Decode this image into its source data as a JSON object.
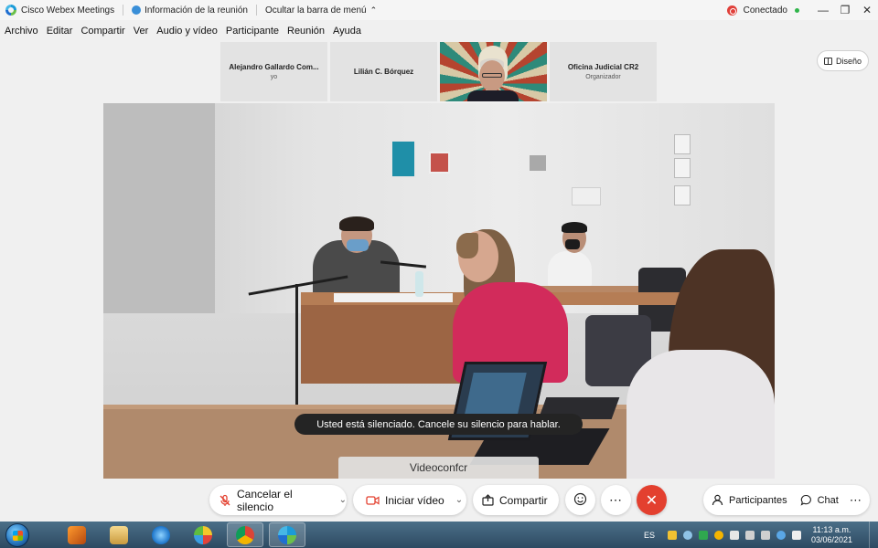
{
  "titlebar": {
    "app_title": "Cisco Webex Meetings",
    "meeting_info": "Información de la reunión",
    "hide_menu": "Ocultar la barra de menú",
    "status": "Conectado",
    "status_color": "#2fb54a"
  },
  "menu": {
    "items": [
      "Archivo",
      "Editar",
      "Compartir",
      "Ver",
      "Audio y vídeo",
      "Participante",
      "Reunión",
      "Ayuda"
    ]
  },
  "participants": [
    {
      "name": "Alejandro Gallardo Com...",
      "role": "yo"
    },
    {
      "name": "Lilián C. Bórquez",
      "role": ""
    },
    {
      "name": "",
      "role": ""
    },
    {
      "name": "Oficina Judicial CR2",
      "role": "Organizador"
    }
  ],
  "layout_button": "Diseño",
  "main_video": {
    "muted_notice": "Usted está silenciado. Cancele su silencio para hablar.",
    "speaker_label": "Videoconfcr"
  },
  "controls": {
    "mute": "Cancelar el silencio",
    "video": "Iniciar vídeo",
    "share": "Compartir",
    "participants": "Participantes",
    "chat": "Chat",
    "end_color": "#e3402f"
  },
  "taskbar": {
    "language": "ES",
    "time": "11:13 a.m.",
    "date": "03/06/2021"
  }
}
